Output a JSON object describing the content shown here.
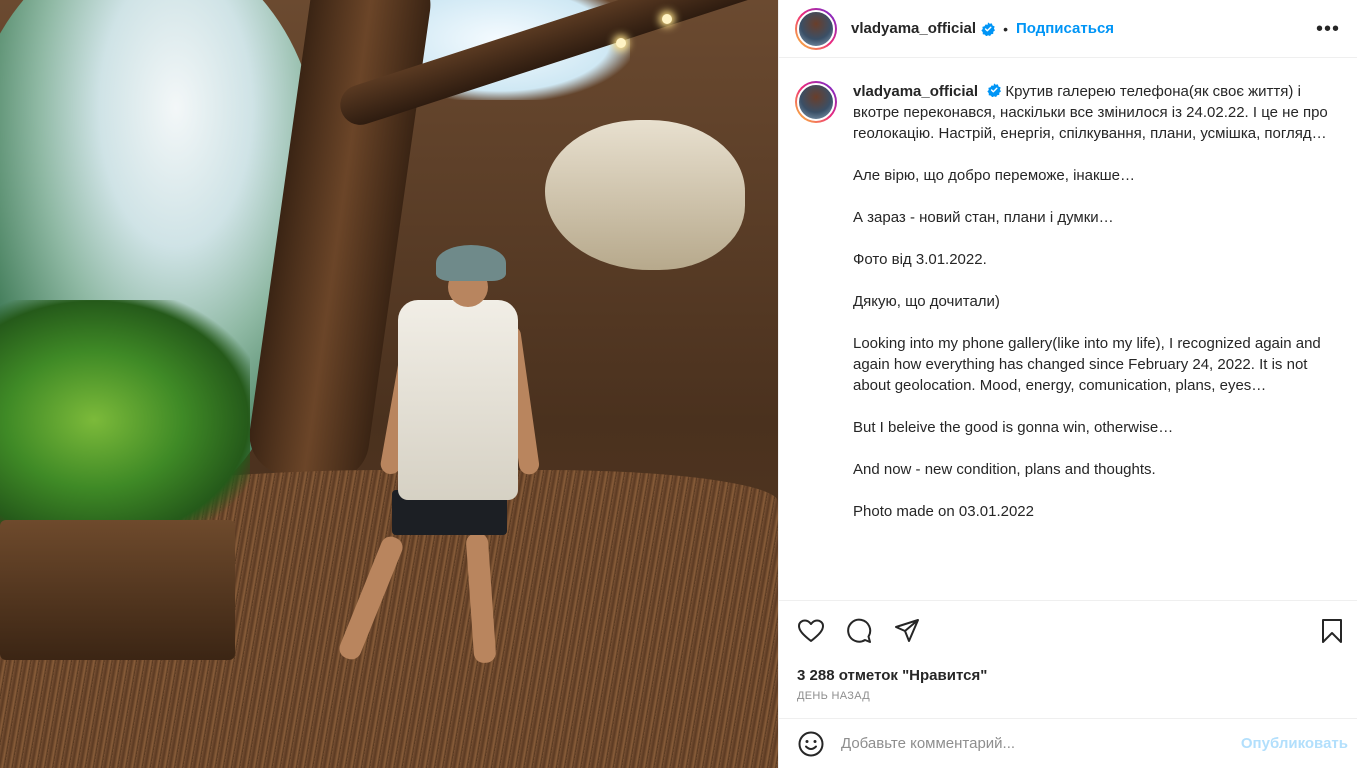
{
  "header": {
    "username": "vladyama_official",
    "dot": "•",
    "follow_label": "Подписаться",
    "more_label": "•••"
  },
  "caption": {
    "username": "vladyama_official",
    "paragraphs": [
      "Крутив галерею телефона(як своє життя) і вкотре переконався, наскільки все змінилося із 24.02.22. І це не про геолокацію. Настрій, енергія, спілкування, плани, усмішка, погляд…",
      "Але вірю, що добро переможе, інакше…",
      "А зараз - новий стан, плани і думки…",
      "Фото від 3.01.2022.",
      "Дякую, що дочитали)",
      "Looking into my phone gallery(like into my life), I recognized again and again how everything has changed since February 24, 2022. It is not about geolocation. Mood, energy, comunication, plans, eyes…",
      "But I beleive the good is gonna win, otherwise…",
      "And now - new condition, plans and thoughts.",
      "Photo made on 03.01.2022"
    ]
  },
  "actions": {
    "likes": "3 288 отметок \"Нравится\"",
    "time": "ДЕНЬ НАЗАД"
  },
  "comment": {
    "placeholder": "Добавьте комментарий...",
    "publish_label": "Опубликовать"
  },
  "colors": {
    "accent": "#0095f6",
    "publish_disabled": "#b2dffc",
    "verified": "#0095f6"
  },
  "icons": [
    "verified-badge-icon",
    "heart-icon",
    "comment-icon",
    "share-icon",
    "bookmark-icon",
    "emoji-icon",
    "more-icon"
  ]
}
